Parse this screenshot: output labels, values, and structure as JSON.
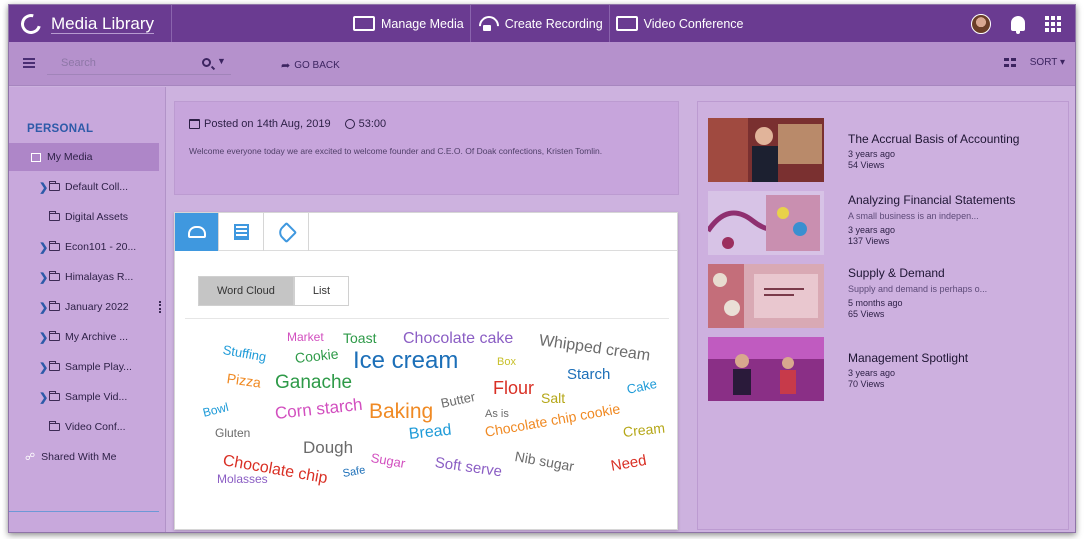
{
  "header": {
    "app_title": "Media Library",
    "nav": [
      "Manage Media",
      "Create Recording",
      "Video Conference"
    ]
  },
  "toolbar": {
    "search_placeholder": "Search",
    "go_back": "GO BACK",
    "sort": "SORT"
  },
  "sidebar": {
    "heading": "PERSONAL",
    "items": [
      {
        "label": "My Media",
        "icon": "home-icon",
        "chevron": false,
        "active": true
      },
      {
        "label": "Default Coll...",
        "icon": "folder-icon",
        "chevron": true
      },
      {
        "label": "Digital Assets",
        "icon": "folder-icon",
        "chevron": false
      },
      {
        "label": "Econ101 - 20...",
        "icon": "folder-icon",
        "chevron": true
      },
      {
        "label": "Himalayas R...",
        "icon": "folder-icon",
        "chevron": true
      },
      {
        "label": "January 2022",
        "icon": "folder-icon",
        "chevron": true
      },
      {
        "label": "My Archive ...",
        "icon": "folder-icon",
        "chevron": true
      },
      {
        "label": "Sample Play...",
        "icon": "folder-icon",
        "chevron": true
      },
      {
        "label": "Sample Vid...",
        "icon": "folder-icon",
        "chevron": true
      },
      {
        "label": "Video Conf...",
        "icon": "folder-icon",
        "chevron": false
      },
      {
        "label": "Shared With Me",
        "icon": "share-icon",
        "chevron": false
      }
    ]
  },
  "media": {
    "posted": "Posted on 14th Aug, 2019",
    "duration": "53:00",
    "description": "Welcome everyone today we are excited to welcome founder and C.E.O. Of Doak confections, Kristen Tomlin."
  },
  "insights": {
    "toggle": [
      "Word Cloud",
      "List"
    ],
    "words": [
      {
        "text": "Market",
        "color": "#d24fbf"
      },
      {
        "text": "Toast",
        "color": "#2e9a48"
      },
      {
        "text": "Chocolate cake",
        "color": "#8b5ec4"
      },
      {
        "text": "Whipped cream",
        "color": "#6b6b6b"
      },
      {
        "text": "Stuffing",
        "color": "#1f9bd8"
      },
      {
        "text": "Cookie",
        "color": "#2e9a48"
      },
      {
        "text": "Ice cream",
        "color": "#1c6fb8"
      },
      {
        "text": "Box",
        "color": "#c8c02a"
      },
      {
        "text": "Starch",
        "color": "#1c6fb8"
      },
      {
        "text": "Pizza",
        "color": "#f08a24"
      },
      {
        "text": "Ganache",
        "color": "#2e9a48"
      },
      {
        "text": "Flour",
        "color": "#d93025"
      },
      {
        "text": "Cake",
        "color": "#1f9bd8"
      },
      {
        "text": "Salt",
        "color": "#b5a718"
      },
      {
        "text": "Bowl",
        "color": "#1f9bd8"
      },
      {
        "text": "Corn starch",
        "color": "#d24fbf"
      },
      {
        "text": "Baking",
        "color": "#f08a24"
      },
      {
        "text": "Butter",
        "color": "#6b6b6b"
      },
      {
        "text": "As is",
        "color": "#6b6b6b"
      },
      {
        "text": "Chocolate chip cookie",
        "color": "#f08a24"
      },
      {
        "text": "Gluten",
        "color": "#6b6b6b"
      },
      {
        "text": "Bread",
        "color": "#1f9bd8"
      },
      {
        "text": "Cream",
        "color": "#b5a718"
      },
      {
        "text": "Dough",
        "color": "#6b6b6b"
      },
      {
        "text": "Chocolate chip",
        "color": "#d93025"
      },
      {
        "text": "Sugar",
        "color": "#d24fbf"
      },
      {
        "text": "Soft serve",
        "color": "#8b5ec4"
      },
      {
        "text": "Nib sugar",
        "color": "#6b6b6b"
      },
      {
        "text": "Need",
        "color": "#d93025"
      },
      {
        "text": "Safe",
        "color": "#1c6fb8"
      },
      {
        "text": "Molasses",
        "color": "#8b5ec4"
      }
    ]
  },
  "related": [
    {
      "title": "The Accrual Basis of Accounting",
      "subtitle": "",
      "age": "3 years ago",
      "views": "54 Views"
    },
    {
      "title": "Analyzing Financial Statements",
      "subtitle": "A small business is an indepen...",
      "age": "3 years ago",
      "views": "137 Views"
    },
    {
      "title": "Supply & Demand",
      "subtitle": "Supply and demand is perhaps o...",
      "age": "5 months ago",
      "views": "65 Views"
    },
    {
      "title": "Management Spotlight",
      "subtitle": "",
      "age": "3 years ago",
      "views": "70 Views"
    }
  ],
  "colors": {
    "topbar": "#6a3b91",
    "accent_blue": "#3f98df",
    "sidebar_heading": "#2d5aa8"
  }
}
